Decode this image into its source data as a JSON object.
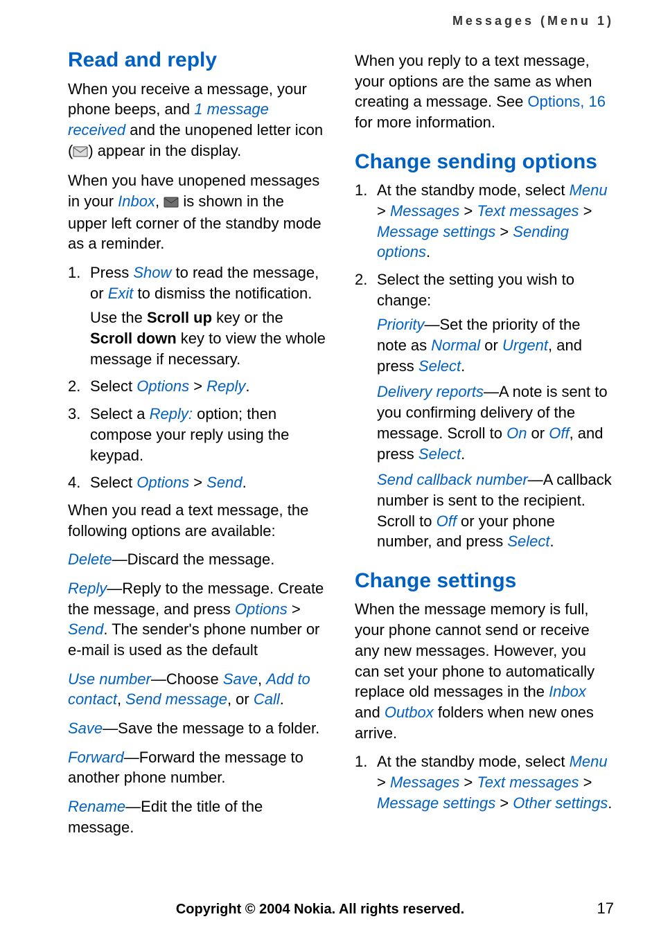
{
  "running_head": "Messages (Menu 1)",
  "left": {
    "h_read": "Read and reply",
    "p1a": "When you receive a message, your phone beeps, and ",
    "p1b": "1 message received",
    "p1c": " and the unopened letter icon (",
    "p1d": ") appear in the display.",
    "p2a": "When you have unopened messages in your ",
    "p2b": "Inbox",
    "p2c": ", ",
    "p2d": " is shown in the upper left corner of the standby mode as a reminder.",
    "s1a": "Press ",
    "s1b": "Show",
    "s1c": " to read the message, or ",
    "s1d": "Exit",
    "s1e": " to dismiss the notification.",
    "s1sub_a": "Use the ",
    "s1sub_b": "Scroll up",
    "s1sub_c": " key or the ",
    "s1sub_d": "Scroll down",
    "s1sub_e": " key to view the whole message if necessary.",
    "s2a": "Select ",
    "s2b": "Options",
    "s2c": " > ",
    "s2d": "Reply",
    "s2e": ".",
    "s3a": "Select a ",
    "s3b": "Reply:",
    "s3c": " option; then compose your reply using the keypad.",
    "s4a": "Select ",
    "s4b": "Options",
    "s4c": " > ",
    "s4d": "Send",
    "s4e": ".",
    "p3": "When you read a text message, the following options are available:",
    "o_del_a": "Delete",
    "o_del_b": "—Discard the message.",
    "o_rep_a": "Reply",
    "o_rep_b": "—Reply to the message. Create the message, and press ",
    "o_rep_c": "Options",
    "o_rep_d": " > ",
    "o_rep_e": "Send",
    "o_rep_f": ". The sender's phone number or e-mail is used as the default",
    "o_use_a": "Use number",
    "o_use_b": "—Choose ",
    "o_use_c": "Save",
    "o_use_d": ", ",
    "o_use_e": "Add to contact",
    "o_use_f": ", ",
    "o_use_g": "Send message",
    "o_use_h": ", or ",
    "o_use_i": "Call",
    "o_use_j": ".",
    "o_save_a": "Save",
    "o_save_b": "—Save the message to a folder.",
    "o_fwd_a": "Forward",
    "o_fwd_b": "—Forward the message to another phone number.",
    "o_ren_a": "Rename",
    "o_ren_b": "—Edit the title of the message."
  },
  "right": {
    "p0a": "When you reply to a text message, your options are the same as when creating a message. See ",
    "p0b": "Options, 16",
    "p0c": " for more information.",
    "h_change_send": "Change sending options",
    "cs1a": "At the standby mode, select ",
    "cs1b": "Menu",
    "cs1c": " > ",
    "cs1d": "Messages",
    "cs1e": " > ",
    "cs1f": "Text messages",
    "cs1g": " > ",
    "cs1h": "Message settings",
    "cs1i": " > ",
    "cs1j": "Sending options",
    "cs1k": ".",
    "cs2a": "Select the setting you wish to change:",
    "pri_a": "Priority",
    "pri_b": "—Set the priority of the note as ",
    "pri_c": "Normal",
    "pri_d": " or ",
    "pri_e": "Urgent",
    "pri_f": ", and press ",
    "pri_g": "Select",
    "pri_h": ".",
    "dr_a": "Delivery reports",
    "dr_b": "—A note is sent to you confirming delivery of the message. Scroll to ",
    "dr_c": "On",
    "dr_d": " or ",
    "dr_e": "Off",
    "dr_f": ", and press ",
    "dr_g": "Select",
    "dr_h": ".",
    "scn_a": "Send callback number",
    "scn_b": "—A callback number is sent to the recipient. Scroll to ",
    "scn_c": "Off",
    "scn_d": " or your phone number, and press ",
    "scn_e": "Select",
    "scn_f": ".",
    "h_change_set": "Change settings",
    "cset_p1a": "When the message memory is full, your phone cannot send or receive any new messages. However, you can set your phone to automatically replace old messages in the ",
    "cset_p1b": "Inbox",
    "cset_p1c": " and ",
    "cset_p1d": "Outbox",
    "cset_p1e": " folders when new ones arrive.",
    "cset_s1a": "At the standby mode, select ",
    "cset_s1b": "Menu",
    "cset_s1c": " > ",
    "cset_s1d": "Messages",
    "cset_s1e": " > ",
    "cset_s1f": "Text messages",
    "cset_s1g": " > ",
    "cset_s1h": "Message settings",
    "cset_s1i": " > ",
    "cset_s1j": "Other settings",
    "cset_s1k": "."
  },
  "footer": {
    "copyright": "Copyright © 2004 Nokia. All rights reserved.",
    "page": "17"
  }
}
